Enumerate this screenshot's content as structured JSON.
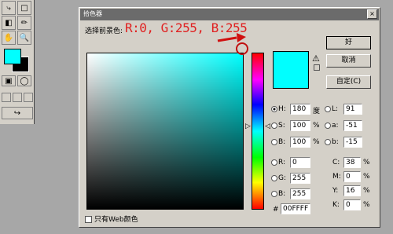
{
  "toolbox": {
    "tools": [
      "lasso-icon",
      "marquee-icon",
      "crop-icon",
      "eyedropper-icon",
      "hand-icon",
      "zoom-icon"
    ],
    "foreground_color": "#00ffff",
    "background_color": "#000000"
  },
  "dialog": {
    "title": "拾色器",
    "close_label": "×",
    "prompt": "选择前景色:",
    "annotation": "R:0, G:255, B:255",
    "new_color": "#00ffff",
    "buttons": {
      "ok": "好",
      "cancel": "取消",
      "custom": "自定(C)"
    },
    "hsb": [
      {
        "label": "H:",
        "value": "180",
        "unit": "度",
        "selected": true
      },
      {
        "label": "S:",
        "value": "100",
        "unit": "%",
        "selected": false
      },
      {
        "label": "B:",
        "value": "100",
        "unit": "%",
        "selected": false
      }
    ],
    "rgb": [
      {
        "label": "R:",
        "value": "0"
      },
      {
        "label": "G:",
        "value": "255"
      },
      {
        "label": "B:",
        "value": "255"
      }
    ],
    "lab": [
      {
        "label": "L:",
        "value": "91"
      },
      {
        "label": "a:",
        "value": "-51"
      },
      {
        "label": "b:",
        "value": "-15"
      }
    ],
    "cmyk": [
      {
        "label": "C:",
        "value": "38",
        "unit": "%"
      },
      {
        "label": "M:",
        "value": "0",
        "unit": "%"
      },
      {
        "label": "Y:",
        "value": "16",
        "unit": "%"
      },
      {
        "label": "K:",
        "value": "0",
        "unit": "%"
      }
    ],
    "hex_label": "#",
    "hex_value": "00FFFF",
    "websafe_label": "只有Web颜色"
  }
}
